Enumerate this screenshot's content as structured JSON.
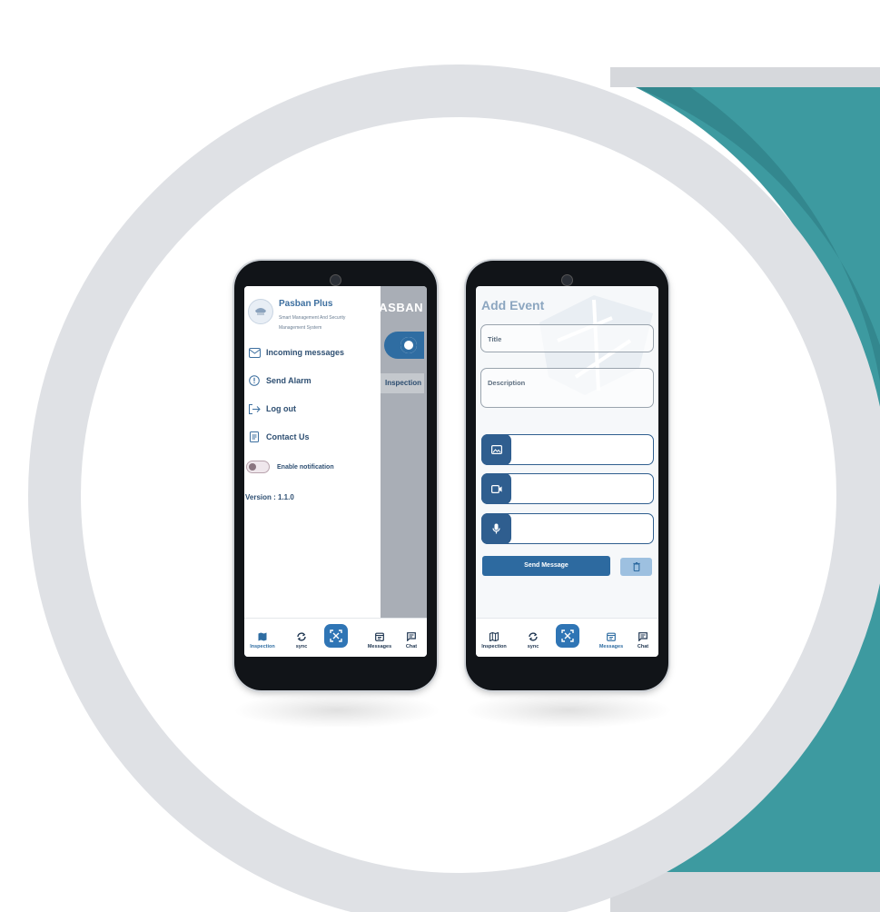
{
  "colors": {
    "accent": "#2f6da2",
    "teal": "#3d9aa0",
    "ring": "#dfe1e5",
    "dark_text": "#1e3550"
  },
  "left_phone": {
    "underlay_brand": "PASBAN",
    "underlay_button": "Inspection",
    "drawer": {
      "app_name": "Pasban Plus",
      "app_subtitle_line1": "Smart Management And Security",
      "app_subtitle_line2": "Management System",
      "menu": [
        {
          "label": "Incoming messages",
          "icon": "mail-icon"
        },
        {
          "label": "Send Alarm",
          "icon": "alert-icon"
        },
        {
          "label": "Log out",
          "icon": "logout-icon"
        },
        {
          "label": "Contact Us",
          "icon": "document-icon"
        }
      ],
      "notification_label": "Enable notification",
      "notification_enabled": false,
      "version": "Version : 1.1.0"
    },
    "nav": [
      {
        "label": "Inspection",
        "icon": "map-icon",
        "active": true
      },
      {
        "label": "sync",
        "icon": "sync-icon",
        "active": false
      },
      {
        "label": "",
        "icon": "scan-icon",
        "active": false
      },
      {
        "label": "Messages",
        "icon": "calendar-icon",
        "active": false
      },
      {
        "label": "Chat",
        "icon": "chat-icon",
        "active": false
      }
    ]
  },
  "right_phone": {
    "title": "Add Event",
    "title_placeholder": "Title",
    "description_placeholder": "Description",
    "media_buttons": [
      "image-icon",
      "video-icon",
      "microphone-icon"
    ],
    "send_label": "Send Message",
    "nav": [
      {
        "label": "Inspection",
        "icon": "map-icon",
        "active": false
      },
      {
        "label": "sync",
        "icon": "sync-icon",
        "active": false
      },
      {
        "label": "",
        "icon": "scan-icon",
        "active": false
      },
      {
        "label": "Messages",
        "icon": "calendar-icon",
        "active": true
      },
      {
        "label": "Chat",
        "icon": "chat-icon",
        "active": false
      }
    ]
  }
}
